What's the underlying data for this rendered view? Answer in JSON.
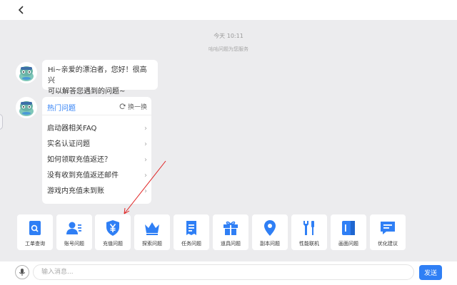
{
  "chat": {
    "time": "今天 10:11",
    "service": "咕咕问题为您服务",
    "greeting_line1": "Hi~亲爱的漂泊者，您好！很高兴",
    "greeting_line2": "可以解答您遇到的问题~"
  },
  "hot": {
    "title": "热门问题",
    "refresh_label": "换一换",
    "items": [
      "启动器相关FAQ",
      "实名认证问题",
      "如何领取充值返还？",
      "没有收到充值返还邮件",
      "游戏内充值未到账"
    ]
  },
  "categories": [
    {
      "label": "工单查询",
      "icon": "ticket-search-icon"
    },
    {
      "label": "账号问题",
      "icon": "account-icon"
    },
    {
      "label": "充值问题",
      "icon": "yen-shield-icon"
    },
    {
      "label": "探索问题",
      "icon": "crown-icon"
    },
    {
      "label": "任务问题",
      "icon": "task-list-icon"
    },
    {
      "label": "道具问题",
      "icon": "gift-icon"
    },
    {
      "label": "副本问题",
      "icon": "location-pin-icon"
    },
    {
      "label": "性能联机",
      "icon": "tools-icon"
    },
    {
      "label": "画面问题",
      "icon": "document-icon"
    },
    {
      "label": "优化建议",
      "icon": "chat-bubble-icon"
    }
  ],
  "input": {
    "placeholder": "输入消息...",
    "send_label": "发送"
  },
  "colors": {
    "accent": "#2f7ff5",
    "background": "#ececee"
  }
}
